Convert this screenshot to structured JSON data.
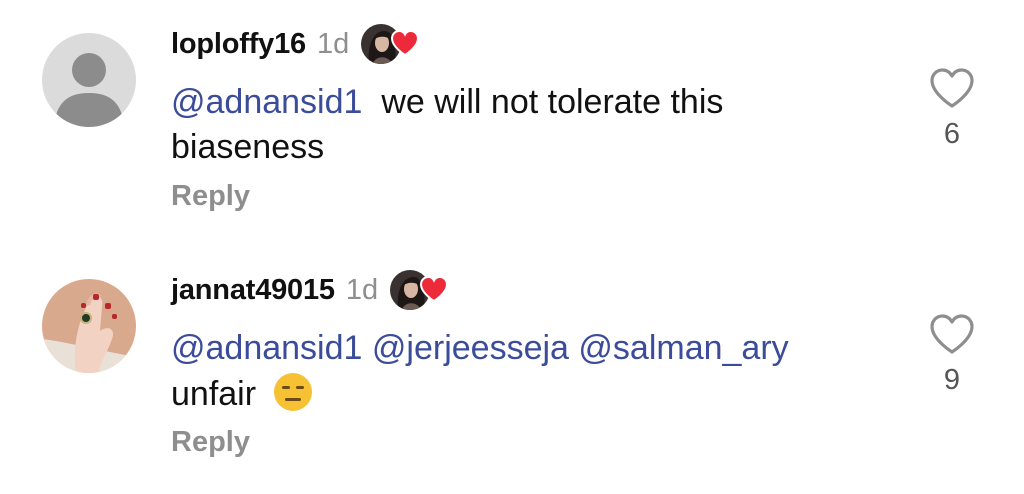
{
  "comments": [
    {
      "username": "loploffy16",
      "time": "1d",
      "mention": "@adnansid1",
      "text_line1": "we will not tolerate this",
      "text_line2": "biaseness",
      "reply_label": "Reply",
      "like_count": "6",
      "avatar_icon": "default-user-icon",
      "liked_by_author": true
    },
    {
      "username": "jannat49015",
      "time": "1d",
      "mentions": [
        "@adnansid1",
        "@jerjeesseja",
        "@salman_ary"
      ],
      "text": "unfair",
      "emoji": "expressionless-face-emoji",
      "reply_label": "Reply",
      "like_count": "9",
      "liked_by_author": true
    }
  ],
  "colors": {
    "mention": "#3b4c9b",
    "muted": "#8e8e8e",
    "heart": "#ed2a3a",
    "emoji": "#f6c233"
  }
}
